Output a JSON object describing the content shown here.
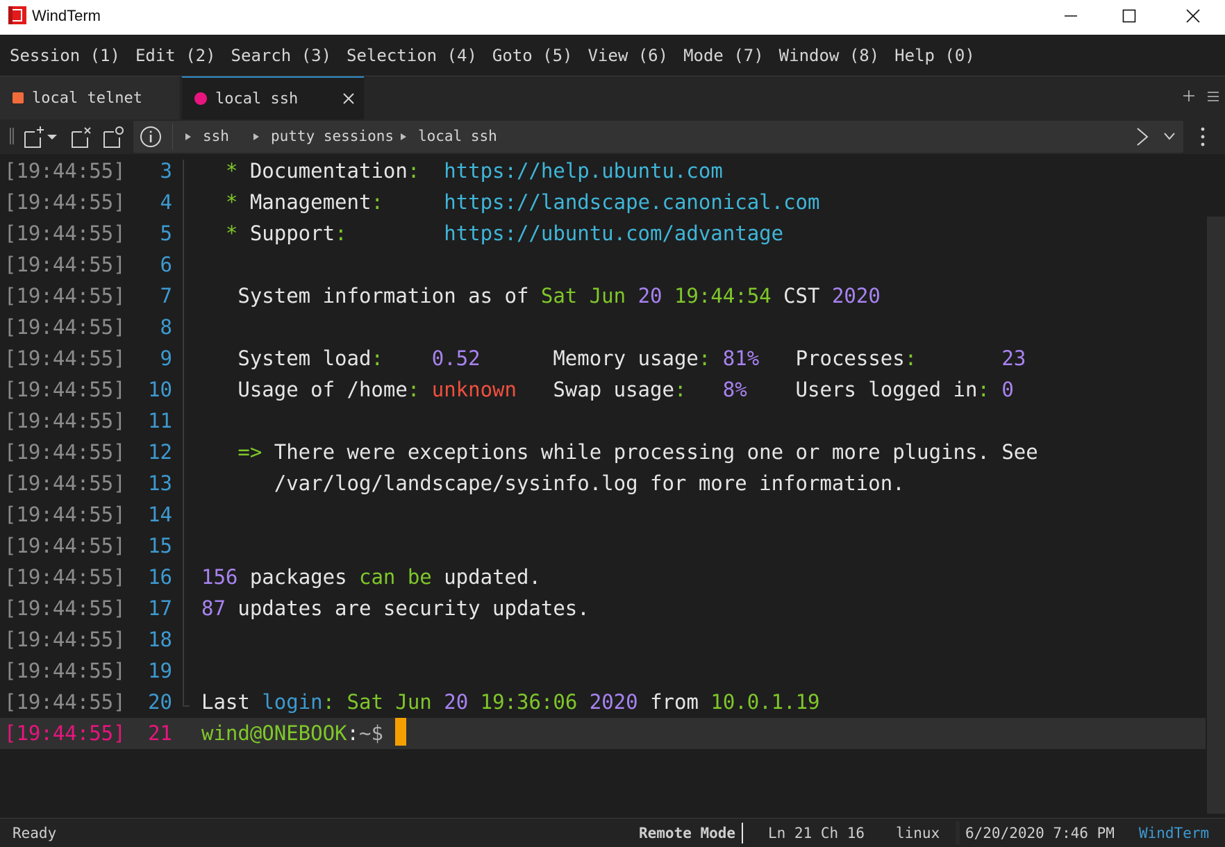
{
  "window": {
    "title": "WindTerm",
    "controls": [
      "minimize",
      "maximize",
      "close"
    ]
  },
  "menu": [
    {
      "label": "Session (1)"
    },
    {
      "label": "Edit (2)"
    },
    {
      "label": "Search (3)"
    },
    {
      "label": "Selection (4)"
    },
    {
      "label": "Goto (5)"
    },
    {
      "label": "View (6)"
    },
    {
      "label": "Mode (7)"
    },
    {
      "label": "Window (8)"
    },
    {
      "label": "Help (0)"
    }
  ],
  "tabs": [
    {
      "label": "local telnet",
      "color": "#f26b3a",
      "active": false
    },
    {
      "label": "local ssh",
      "color": "#e8157e",
      "active": true
    }
  ],
  "breadcrumb": [
    "ssh",
    "putty sessions",
    "local ssh"
  ],
  "terminal": {
    "timestamp": "[19:44:55]",
    "lines": [
      {
        "n": "3",
        "segments": [
          {
            "t": "  * ",
            "c": "green"
          },
          {
            "t": "Documentation",
            "c": "white"
          },
          {
            "t": ":  ",
            "c": "green"
          },
          {
            "t": "https://help.ubuntu.com",
            "c": "cyan"
          }
        ]
      },
      {
        "n": "4",
        "segments": [
          {
            "t": "  * ",
            "c": "green"
          },
          {
            "t": "Management",
            "c": "white"
          },
          {
            "t": ":     ",
            "c": "green"
          },
          {
            "t": "https://landscape.canonical.com",
            "c": "cyan"
          }
        ]
      },
      {
        "n": "5",
        "segments": [
          {
            "t": "  * ",
            "c": "green"
          },
          {
            "t": "Support",
            "c": "white"
          },
          {
            "t": ":        ",
            "c": "green"
          },
          {
            "t": "https://ubuntu.com/advantage",
            "c": "cyan"
          }
        ]
      },
      {
        "n": "6",
        "segments": []
      },
      {
        "n": "7",
        "segments": [
          {
            "t": "   System information as of ",
            "c": "white"
          },
          {
            "t": "Sat Jun ",
            "c": "green"
          },
          {
            "t": "20",
            "c": "purple"
          },
          {
            "t": " 19:44:54 ",
            "c": "green"
          },
          {
            "t": "CST ",
            "c": "white"
          },
          {
            "t": "2020",
            "c": "purple"
          }
        ]
      },
      {
        "n": "8",
        "segments": []
      },
      {
        "n": "9",
        "segments": [
          {
            "t": "   System load",
            "c": "white"
          },
          {
            "t": ":    ",
            "c": "green"
          },
          {
            "t": "0.52",
            "c": "purple"
          },
          {
            "t": "      Memory usage",
            "c": "white"
          },
          {
            "t": ": ",
            "c": "green"
          },
          {
            "t": "81%",
            "c": "purple"
          },
          {
            "t": "   Processes",
            "c": "white"
          },
          {
            "t": ":       ",
            "c": "green"
          },
          {
            "t": "23",
            "c": "purple"
          }
        ]
      },
      {
        "n": "10",
        "segments": [
          {
            "t": "   Usage of /home",
            "c": "white"
          },
          {
            "t": ": ",
            "c": "green"
          },
          {
            "t": "unknown",
            "c": "red"
          },
          {
            "t": "   Swap usage",
            "c": "white"
          },
          {
            "t": ":   ",
            "c": "green"
          },
          {
            "t": "8%",
            "c": "purple"
          },
          {
            "t": "    Users logged in",
            "c": "white"
          },
          {
            "t": ": ",
            "c": "green"
          },
          {
            "t": "0",
            "c": "purple"
          }
        ]
      },
      {
        "n": "11",
        "segments": []
      },
      {
        "n": "12",
        "segments": [
          {
            "t": "   => ",
            "c": "green"
          },
          {
            "t": "There were exceptions while processing one or more plugins. See",
            "c": "white"
          }
        ]
      },
      {
        "n": "13",
        "segments": [
          {
            "t": "      /var/log/landscape/sysinfo.log for more information.",
            "c": "white"
          }
        ]
      },
      {
        "n": "14",
        "segments": []
      },
      {
        "n": "15",
        "segments": []
      },
      {
        "n": "16",
        "segments": [
          {
            "t": "156",
            "c": "purple"
          },
          {
            "t": " packages ",
            "c": "white"
          },
          {
            "t": "can be",
            "c": "green"
          },
          {
            "t": " updated.",
            "c": "white"
          }
        ]
      },
      {
        "n": "17",
        "segments": [
          {
            "t": "87",
            "c": "purple"
          },
          {
            "t": " updates are security updates.",
            "c": "white"
          }
        ]
      },
      {
        "n": "18",
        "segments": []
      },
      {
        "n": "19",
        "segments": []
      },
      {
        "n": "20",
        "segments": [
          {
            "t": "Last ",
            "c": "white"
          },
          {
            "t": "login",
            "c": "blue"
          },
          {
            "t": ": ",
            "c": "green"
          },
          {
            "t": "Sat Jun ",
            "c": "green"
          },
          {
            "t": "20",
            "c": "purple"
          },
          {
            "t": " 19:36:06 ",
            "c": "green"
          },
          {
            "t": "2020",
            "c": "purple"
          },
          {
            "t": " from ",
            "c": "white"
          },
          {
            "t": "10.0.1.19",
            "c": "green"
          }
        ]
      },
      {
        "n": "21",
        "current": true,
        "segments": [
          {
            "t": "wind@ONEBOOK",
            "c": "green"
          },
          {
            "t": ":",
            "c": "white"
          },
          {
            "t": "~$ ",
            "c": "gray"
          }
        ]
      }
    ]
  },
  "status": {
    "ready": "Ready",
    "mode": "Remote Mode",
    "position": "Ln 21 Ch 16",
    "os": "linux",
    "datetime": "6/20/2020 7:46 PM",
    "brand": "WindTerm"
  },
  "colors": {
    "accent": "#2d8cc8",
    "current_line": "#e8157e",
    "cursor": "#f5a000"
  },
  "icons": [
    "windterm-logo-icon",
    "minimize-icon",
    "maximize-icon",
    "close-icon",
    "tab-close-icon",
    "new-tab-icon",
    "tab-menu-icon",
    "new-session-icon",
    "dropdown-icon",
    "close-session-icon",
    "duplicate-session-icon",
    "info-icon",
    "breadcrumb-arrow-icon",
    "next-icon",
    "chevron-down-icon",
    "kebab-icon"
  ]
}
